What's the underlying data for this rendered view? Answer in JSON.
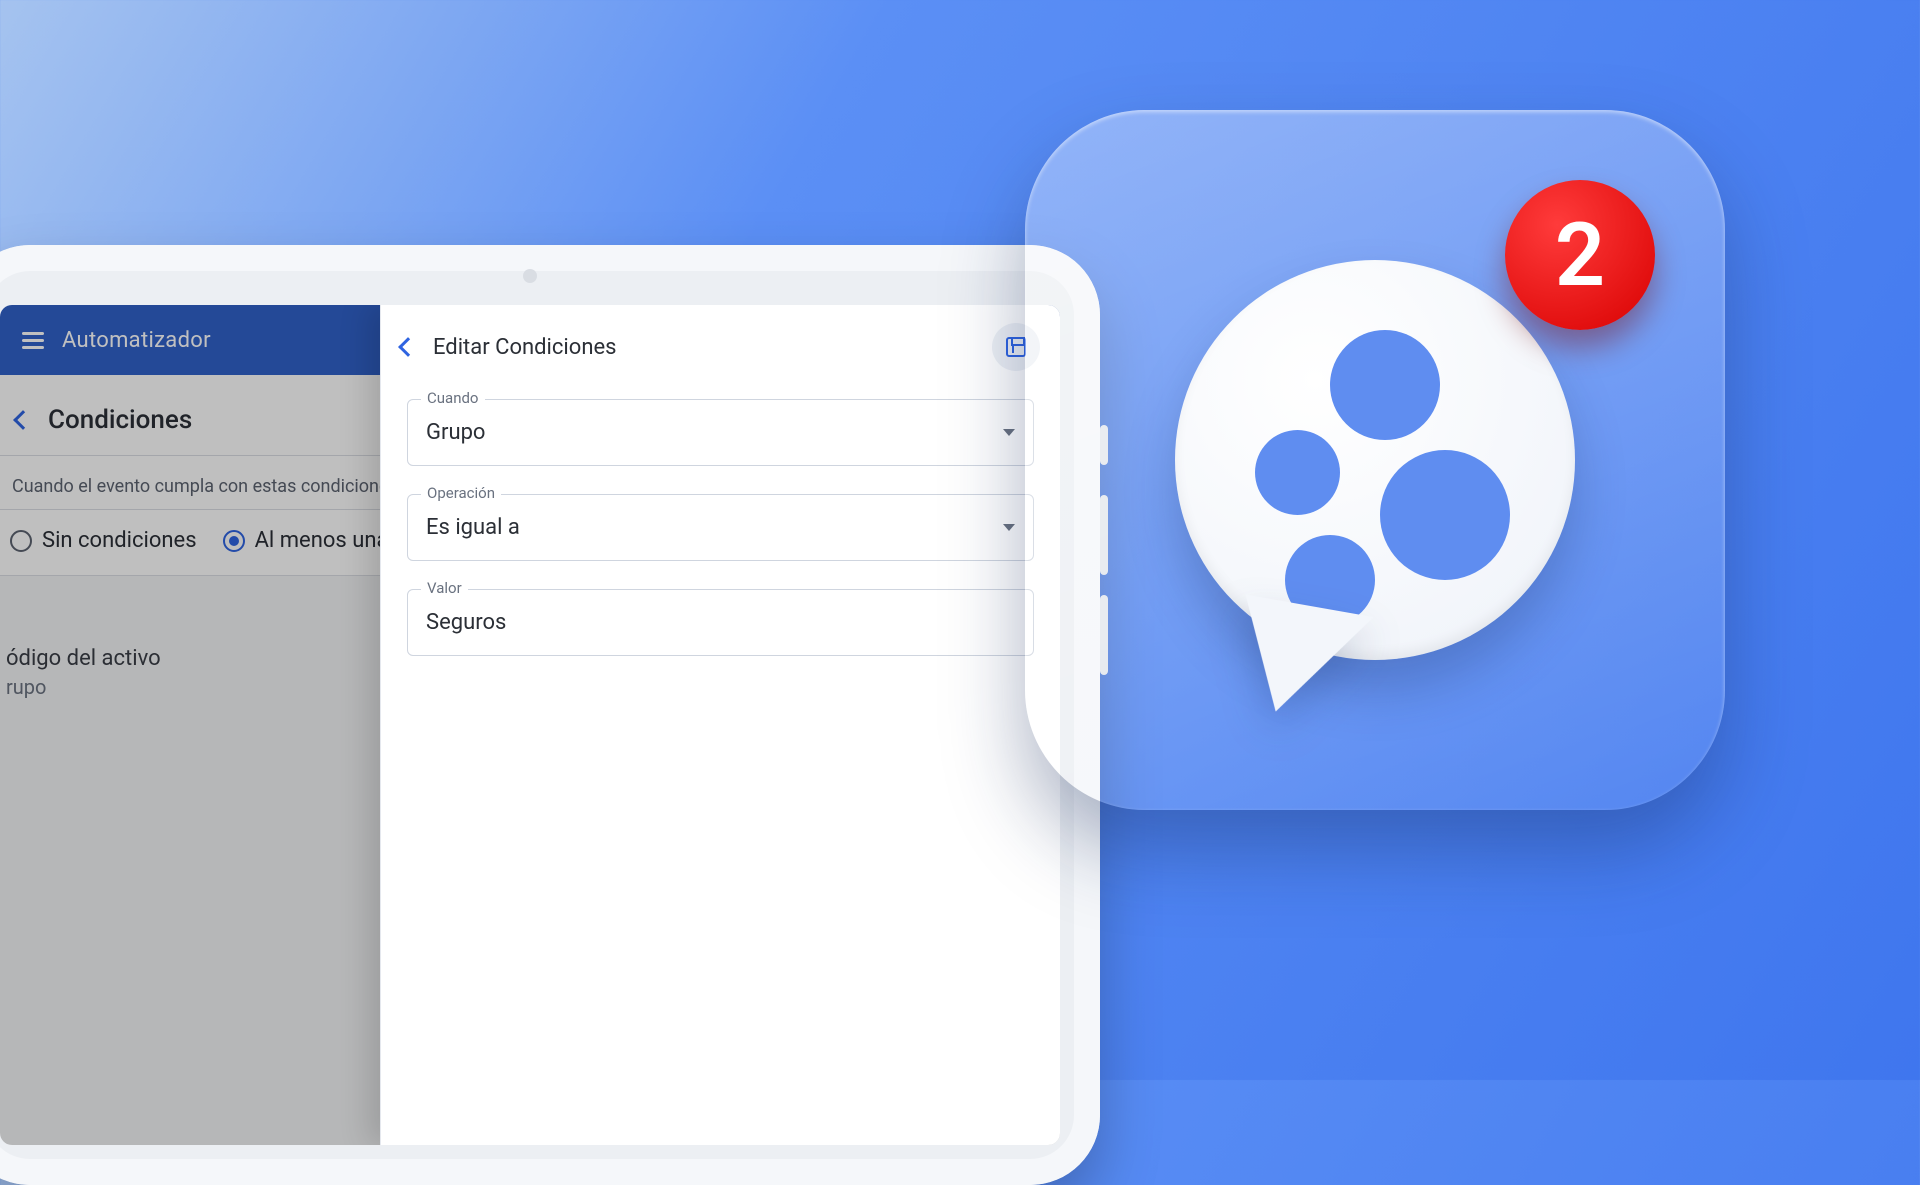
{
  "back_app": {
    "topbar_title": "Automatizador",
    "subheader_title": "Condiciones",
    "section_text": "Cuando el evento cumpla con estas condiciones :",
    "radio_none": "Sin condiciones",
    "radio_atleast": "Al menos una",
    "list_item_title": "ódigo del activo",
    "list_item_sub": "rupo"
  },
  "panel": {
    "title": "Editar Condiciones",
    "fields": {
      "cuando": {
        "label": "Cuando",
        "value": "Grupo"
      },
      "operacion": {
        "label": "Operación",
        "value": "Es igual a"
      },
      "valor": {
        "label": "Valor",
        "value": "Seguros"
      }
    }
  },
  "badge_count": "2"
}
